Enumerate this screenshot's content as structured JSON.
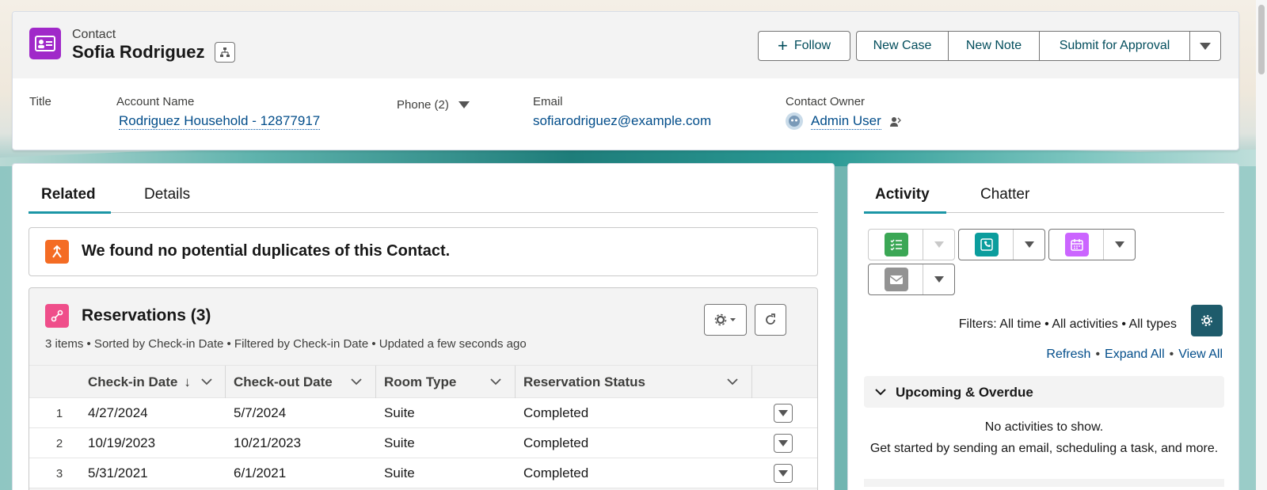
{
  "header": {
    "object_label": "Contact",
    "record_name": "Sofia Rodriguez",
    "buttons": {
      "follow": "Follow",
      "new_case": "New Case",
      "new_note": "New Note",
      "submit_for_approval": "Submit for Approval"
    },
    "fields": {
      "title_label": "Title",
      "account_label": "Account Name",
      "account_value": "Rodriguez Household - 12877917",
      "phone_label": "Phone (2)",
      "email_label": "Email",
      "email_value": "sofiarodriguez@example.com",
      "owner_label": "Contact Owner",
      "owner_value": "Admin User"
    }
  },
  "main": {
    "tabs": [
      "Related",
      "Details"
    ],
    "duplicate_message": "We found no potential duplicates of this Contact.",
    "related_list": {
      "title": "Reservations (3)",
      "meta": "3 items • Sorted by Check-in Date • Filtered by Check-in Date • Updated a few seconds ago",
      "columns": [
        "Check-in Date",
        "Check-out Date",
        "Room Type",
        "Reservation Status"
      ],
      "rows": [
        {
          "num": "1",
          "checkin": "4/27/2024",
          "checkout": "5/7/2024",
          "room": "Suite",
          "status": "Completed"
        },
        {
          "num": "2",
          "checkin": "10/19/2023",
          "checkout": "10/21/2023",
          "room": "Suite",
          "status": "Completed"
        },
        {
          "num": "3",
          "checkin": "5/31/2021",
          "checkout": "6/1/2021",
          "room": "Suite",
          "status": "Completed"
        }
      ]
    }
  },
  "activity": {
    "tabs": [
      "Activity",
      "Chatter"
    ],
    "filters": "Filters: All time • All activities • All types",
    "links": {
      "refresh": "Refresh",
      "expand_all": "Expand All",
      "view_all": "View All"
    },
    "upcoming_label": "Upcoming & Overdue",
    "empty_line1": "No activities to show.",
    "empty_line2": "Get started by sending an email, scheduling a task, and more."
  },
  "colors": {
    "contact_icon": "#a028c9",
    "duplicate_icon": "#f46c24",
    "reservation_icon": "#ef4e8a",
    "task_icon": "#3ba755",
    "call_icon": "#0b9d9d",
    "event_icon": "#cb65ff",
    "email_icon": "#939393",
    "tab_underline": "#1b96a6"
  }
}
